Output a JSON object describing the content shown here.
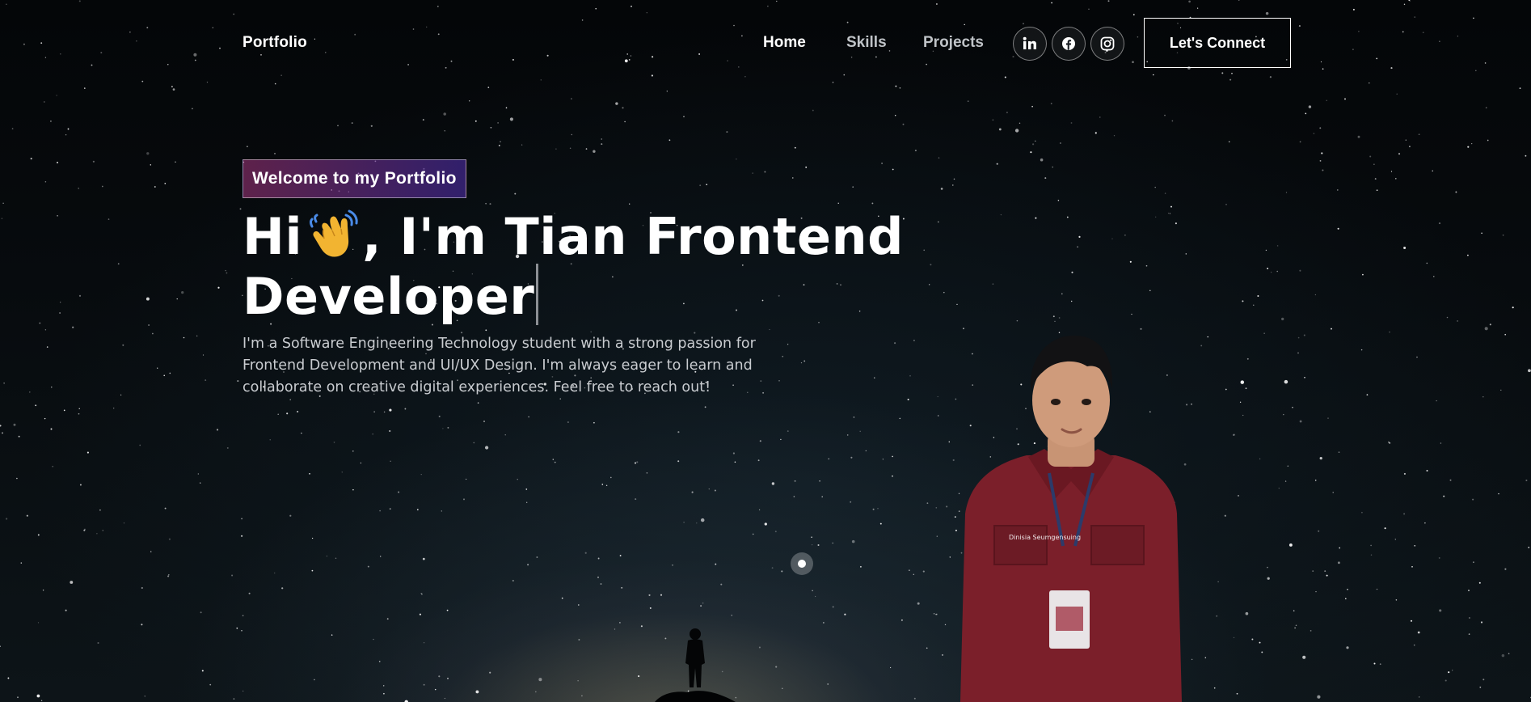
{
  "nav": {
    "brand": "Portfolio",
    "links": [
      {
        "label": "Home",
        "state": "active"
      },
      {
        "label": "Skills",
        "state": "default"
      },
      {
        "label": "Projects",
        "state": "default"
      }
    ],
    "social_icons": [
      "linkedin-icon",
      "facebook-icon",
      "instagram-icon"
    ],
    "cta_label": "Let's Connect"
  },
  "hero": {
    "tagline": "Welcome to my Portfolio",
    "greeting_prefix": "Hi",
    "greeting_emoji": "waving-hand-icon",
    "greeting_suffix": ", I'm Tian Frontend Developer",
    "description": "I'm a Software Engineering Technology student with a strong passion for Frontend Development and UI/UX Design. I'm always eager to learn and collaborate on creative digital experiences. Feel free to reach out!",
    "portrait_badge_text": "Dinisia Seumgensuing"
  },
  "colors": {
    "background": "#05080b",
    "text": "#ffffff",
    "muted_text": "#c9ccd0",
    "tagline_gradient_start": "#aa367c",
    "tagline_gradient_end": "#4a2fbd",
    "shirt": "#7b1f2a"
  }
}
